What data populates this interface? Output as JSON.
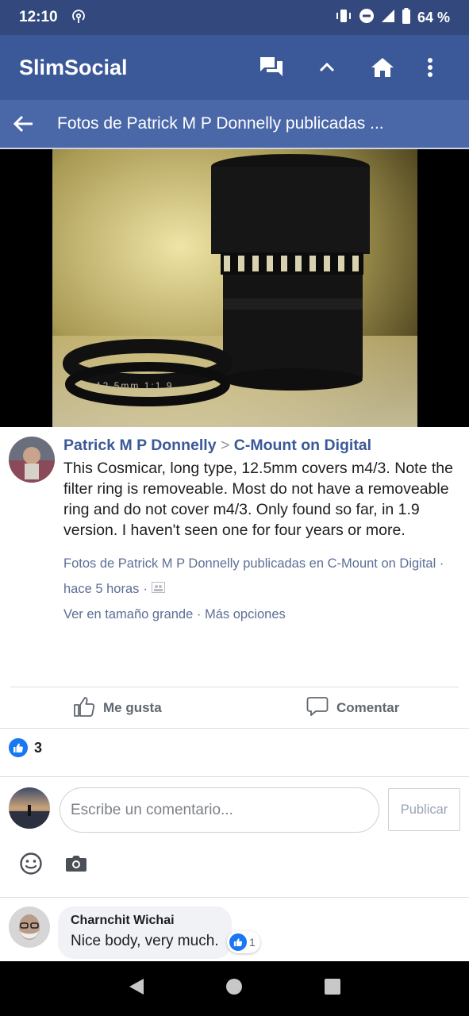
{
  "status_bar": {
    "time": "12:10",
    "battery": "64 %"
  },
  "app_bar": {
    "title": "SlimSocial",
    "icons": [
      "messages-icon",
      "chevron-up-icon",
      "home-icon",
      "more-vert-icon"
    ]
  },
  "sub_bar": {
    "title": "Fotos de Patrick M P Donnelly publicadas ..."
  },
  "post": {
    "author": "Patrick M P Donnelly",
    "separator": ">",
    "group": "C-Mount on Digital",
    "text": "This Cosmicar, long type, 12.5mm covers m4/3. Note the filter ring is removeable. Most do not have a removeable ring and do not cover m4/3. Only found so far, in 1.9 version. I haven't seen one for four years or more.",
    "album_link": "Fotos de Patrick M P Donnelly publicadas en C-Mount on Digital",
    "time": "hace 5 horas",
    "view_full": "Ver en tamaño grande",
    "more_options": "Más opciones",
    "photo_text": "12.5mm  1:1.9"
  },
  "actions": {
    "like": "Me gusta",
    "comment": "Comentar"
  },
  "likes_count": "3",
  "composer": {
    "placeholder": "Escribe un comentario...",
    "publish": "Publicar"
  },
  "comments": [
    {
      "author": "Charnchit Wichai",
      "text": "Nice body, very much.",
      "reactions": "1"
    }
  ],
  "colors": {
    "brand": "#3b5998",
    "status_bar": "#33497e",
    "sub_bar": "#4a67a8",
    "link": "#5d6f96",
    "like_blue": "#1877f2"
  }
}
